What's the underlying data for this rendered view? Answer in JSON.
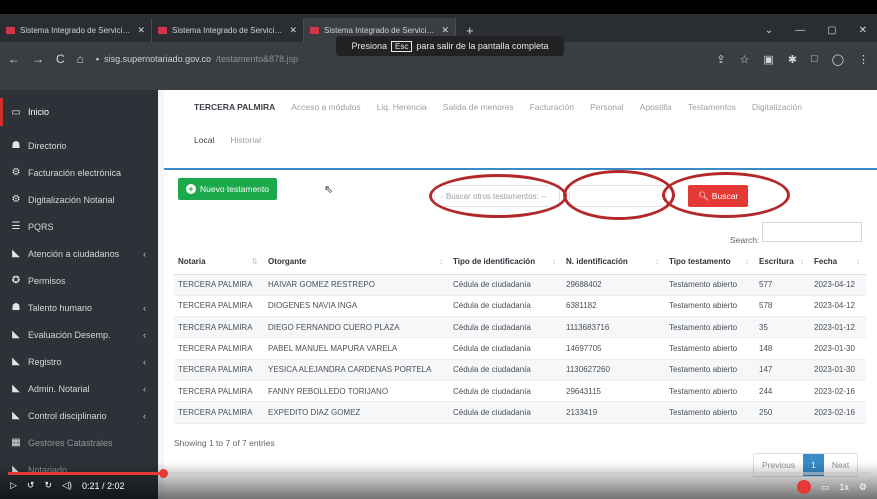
{
  "browser": {
    "tabs": [
      {
        "title": "Sistema Integrado de Servicios y"
      },
      {
        "title": "Sistema Integrado de Servicios y"
      },
      {
        "title": "Sistema Integrado de Servicios y"
      }
    ],
    "url_host": "sisg.supernotariado.gov.co",
    "url_path": "/testamento&878.jsp",
    "fullscreen_prefix": "Presiona",
    "fullscreen_key": "Esc",
    "fullscreen_suffix": "para salir de la pantalla completa"
  },
  "sidebar": {
    "items": [
      {
        "label": "Inicio",
        "icon": "monitor-icon"
      },
      {
        "label": "Directorio",
        "icon": "users-icon"
      },
      {
        "label": "Facturación electrónica",
        "icon": "gears-icon"
      },
      {
        "label": "Digitalización Notarial",
        "icon": "gears-icon"
      },
      {
        "label": "PQRS",
        "icon": "list-icon"
      },
      {
        "label": "Atención a ciudadanos",
        "icon": "tag-icon"
      },
      {
        "label": "Permisos",
        "icon": "compass-icon"
      },
      {
        "label": "Talento humano",
        "icon": "users-icon"
      },
      {
        "label": "Evaluación Desemp.",
        "icon": "tag-icon"
      },
      {
        "label": "Registro",
        "icon": "tag-icon"
      },
      {
        "label": "Admin. Notarial",
        "icon": "tag-icon"
      },
      {
        "label": "Control disciplinario",
        "icon": "tag-icon"
      },
      {
        "label": "Gestores Catastrales",
        "icon": "grid-icon"
      },
      {
        "label": "Notariado",
        "icon": "tag-icon"
      }
    ]
  },
  "topnav": {
    "row1": [
      "TERCERA PALMIRA",
      "Acceso a módulos",
      "Liq. Herencia",
      "Salida de menores",
      "Facturación",
      "Personal",
      "Apostilla",
      "Testamentos",
      "Digitalización"
    ],
    "row2": [
      "Local",
      "Historial"
    ]
  },
  "toolbar": {
    "new_label": "Nuevo testamento",
    "select_placeholder": "- Buscar otros testamentos: --",
    "search_button": "Buscar",
    "table_search_label": "Search:"
  },
  "table": {
    "headers": [
      "Notaria",
      "Otorgante",
      "Tipo de identificación",
      "N. identificación",
      "Tipo testamento",
      "Escritura",
      "Fecha"
    ],
    "rows": [
      [
        "TERCERA PALMIRA",
        "HAIVAR GOMEZ RESTREPO",
        "Cédula de ciudadanía",
        "29688402",
        "Testamento abierto",
        "577",
        "2023-04-12"
      ],
      [
        "TERCERA PALMIRA",
        "DIOGENES NAVIA INGA",
        "Cédula de ciudadanía",
        "6381182",
        "Testamento abierto",
        "578",
        "2023-04-12"
      ],
      [
        "TERCERA PALMIRA",
        "DIEGO FERNANDO CUERO PLAZA",
        "Cédula de ciudadanía",
        "1113683716",
        "Testamento abierto",
        "35",
        "2023-01-12"
      ],
      [
        "TERCERA PALMIRA",
        "PABEL MANUEL MAPURA VARELA",
        "Cédula de ciudadanía",
        "14697705",
        "Testamento abierto",
        "148",
        "2023-01-30"
      ],
      [
        "TERCERA PALMIRA",
        "YESICA ALEJANDRA CARDENAS PORTELA",
        "Cédula de ciudadanía",
        "1130627260",
        "Testamento abierto",
        "147",
        "2023-01-30"
      ],
      [
        "TERCERA PALMIRA",
        "FANNY REBOLLEDO TORIJANO",
        "Cédula de ciudadanía",
        "29643115",
        "Testamento abierto",
        "244",
        "2023-02-16"
      ],
      [
        "TERCERA PALMIRA",
        "EXPEDITO DIAZ GOMEZ",
        "Cédula de ciudadanía",
        "2133419",
        "Testamento abierto",
        "250",
        "2023-02-16"
      ]
    ],
    "info": "Showing 1 to 7 of 7 entries",
    "pager": {
      "prev": "Previous",
      "page": "1",
      "next": "Next"
    }
  },
  "video": {
    "time": "0:21 / 2:02",
    "progress": 0.18,
    "speed": "1x"
  },
  "colors": {
    "accent_blue": "#3a8bc8",
    "success_green": "#1ba94c",
    "danger_red": "#e53935",
    "annotation_ring": "#b3292a",
    "sidebar_bg": "#2c3237"
  }
}
